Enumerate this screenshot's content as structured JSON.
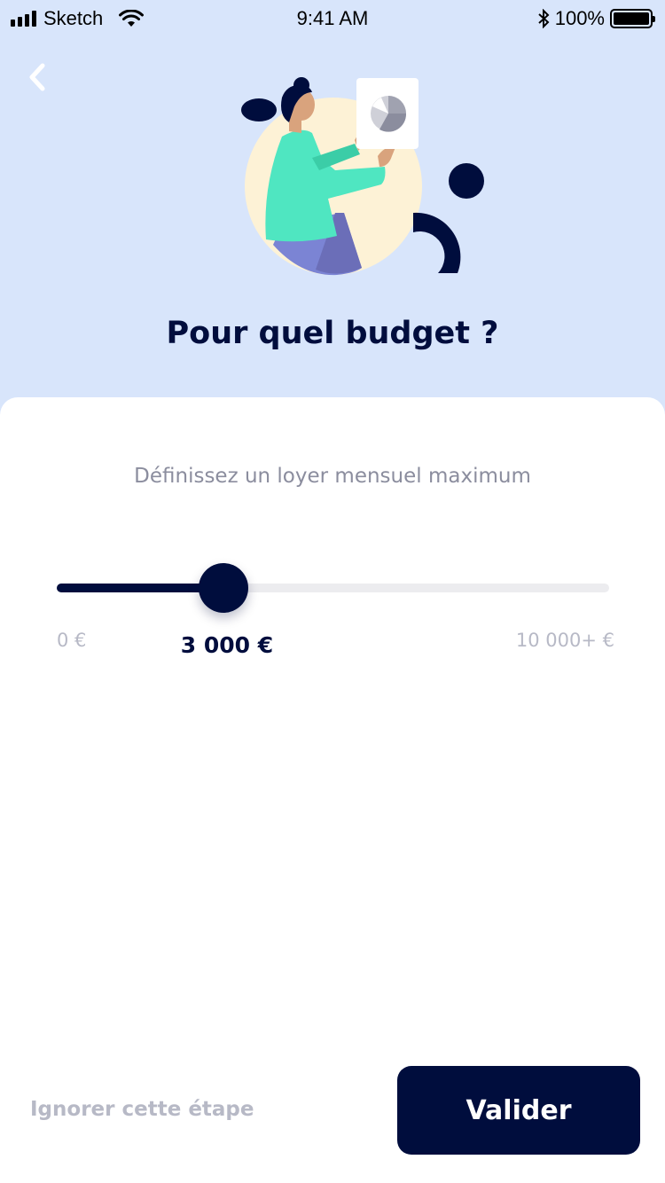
{
  "status_bar": {
    "carrier": "Sketch",
    "time": "9:41 AM",
    "battery": "100%",
    "icons": [
      "signal-icon",
      "wifi-icon",
      "bluetooth-icon",
      "battery-icon"
    ]
  },
  "header": {
    "back_icon": "chevron-left-icon",
    "title": "Pour quel budget ?",
    "illustration": "woman-holding-chart-illustration"
  },
  "budget": {
    "subtitle": "Définissez un loyer mensuel maximum",
    "min_label": "0 €",
    "max_label": "10 000+ €",
    "value_label": "3 000 €",
    "value": 3000,
    "min": 0,
    "max": 10000
  },
  "footer": {
    "skip_label": "Ignorer cette étape",
    "validate_label": "Valider"
  },
  "colors": {
    "background": "#d8e5fb",
    "primary": "#000d3d",
    "muted": "#b7b9c6",
    "subtitle": "#8b8d9e",
    "accent_green": "#4fe6c1",
    "accent_cream": "#fdf2d6"
  }
}
